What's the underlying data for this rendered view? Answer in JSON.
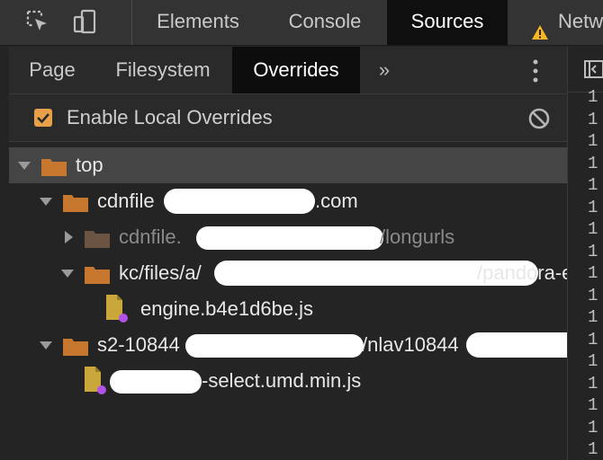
{
  "main_tabs": [
    "Elements",
    "Console",
    "Sources",
    "Netw"
  ],
  "sub_tabs": [
    "Page",
    "Filesystem",
    "Overrides"
  ],
  "more_symbol": "»",
  "enable_overrides": {
    "label": "Enable Local Overrides",
    "checked": true
  },
  "tree": {
    "root": "top",
    "domain1": {
      "prefix": "cdnfile",
      "suffix": ".com"
    },
    "longurls": {
      "prefix": "cdnfile.",
      "suffix": "/longurls"
    },
    "kc": {
      "prefix": "kc/files/a/",
      "suffix": "/pandora-el"
    },
    "file1": "engine.b4e1d6be.js",
    "domain2": {
      "prefix": "s2-10844",
      "suffix": "/nlav10844"
    },
    "file2": "-select.umd.min.js"
  },
  "line_number_text": "1",
  "colors": {
    "accent_checkbox": "#e8a04a",
    "folder_orange": "#c8782e",
    "folder_brown": "#6b5442",
    "file_yellow": "#c9a73a",
    "override_dot": "#b251e8",
    "warning": "#f6b526"
  }
}
